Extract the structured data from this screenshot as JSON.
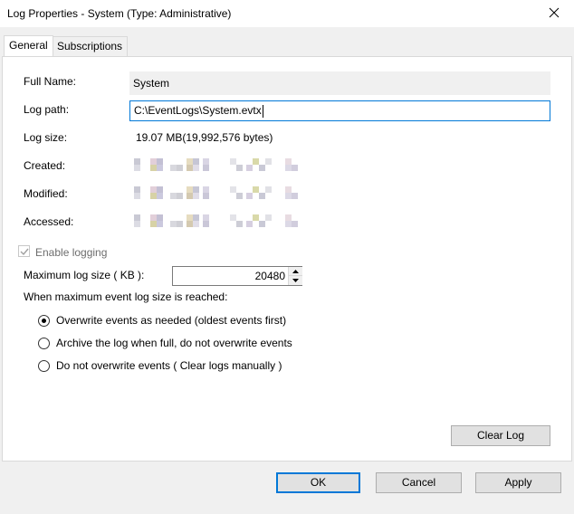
{
  "window": {
    "title": "Log Properties - System (Type: Administrative)"
  },
  "tabs": [
    {
      "label": "General",
      "active": true
    },
    {
      "label": "Subscriptions",
      "active": false
    }
  ],
  "general": {
    "full_name_label": "Full Name:",
    "full_name_value": "System",
    "log_path_label": "Log path:",
    "log_path_value": "C:\\EventLogs\\System.evtx",
    "log_size_label": "Log size:",
    "log_size_value": "19.07 MB(19,992,576 bytes)",
    "created_label": "Created:",
    "modified_label": "Modified:",
    "accessed_label": "Accessed:",
    "enable_logging_label": "Enable logging",
    "enable_logging_checked": true,
    "max_size_label": "Maximum log size ( KB ):",
    "max_size_value": "20480",
    "when_max_label": "When maximum event log size is reached:",
    "retention_options": [
      {
        "label": "Overwrite events as needed (oldest events first)",
        "selected": true
      },
      {
        "label": "Archive the log when full, do not overwrite events",
        "selected": false
      },
      {
        "label": "Do not overwrite events ( Clear logs manually )",
        "selected": false
      }
    ],
    "clear_log_label": "Clear Log"
  },
  "footer": {
    "ok_label": "OK",
    "cancel_label": "Cancel",
    "apply_label": "Apply"
  },
  "colors": {
    "accent": "#0078d7",
    "panel_bg": "#ffffff",
    "window_bg": "#f0f0f0"
  }
}
